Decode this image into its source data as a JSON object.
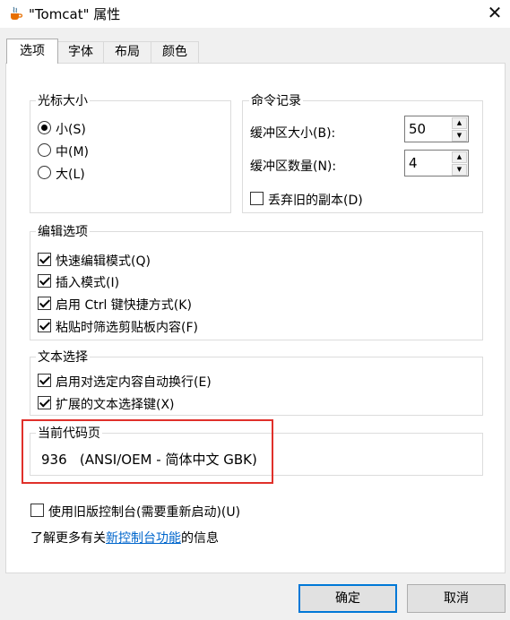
{
  "window": {
    "title": "\"Tomcat\" 属性",
    "close_glyph": "✕",
    "icon": "java-cup-icon"
  },
  "tabs": [
    {
      "label": "选项",
      "active": true
    },
    {
      "label": "字体",
      "active": false
    },
    {
      "label": "布局",
      "active": false
    },
    {
      "label": "颜色",
      "active": false
    }
  ],
  "cursor_size": {
    "legend": "光标大小",
    "options": [
      {
        "label": "小(S)",
        "selected": true
      },
      {
        "label": "中(M)",
        "selected": false
      },
      {
        "label": "大(L)",
        "selected": false
      }
    ]
  },
  "command_history": {
    "legend": "命令记录",
    "buffer_size_label": "缓冲区大小(B):",
    "buffer_size_value": "50",
    "buffer_count_label": "缓冲区数量(N):",
    "buffer_count_value": "4",
    "discard_label": "丢弃旧的副本(D)",
    "discard_checked": false
  },
  "edit_options": {
    "legend": "编辑选项",
    "items": [
      {
        "label": "快速编辑模式(Q)",
        "checked": true
      },
      {
        "label": "插入模式(I)",
        "checked": true
      },
      {
        "label": "启用 Ctrl 键快捷方式(K)",
        "checked": true
      },
      {
        "label": "粘贴时筛选剪贴板内容(F)",
        "checked": true
      }
    ]
  },
  "text_selection": {
    "legend": "文本选择",
    "items": [
      {
        "label": "启用对选定内容自动换行(E)",
        "checked": true
      },
      {
        "label": "扩展的文本选择键(X)",
        "checked": true
      }
    ]
  },
  "code_page": {
    "legend": "当前代码页",
    "value": "936   (ANSI/OEM - 简体中文 GBK)"
  },
  "legacy_console": {
    "label": "使用旧版控制台(需要重新启动)(U)",
    "checked": false
  },
  "info": {
    "prefix": "了解更多有关",
    "link": "新控制台功能",
    "suffix": "的信息"
  },
  "buttons": {
    "ok": "确定",
    "cancel": "取消"
  },
  "colors": {
    "highlight_border": "#e0302a",
    "link": "#0066cc",
    "default_button_border": "#0078d7"
  }
}
